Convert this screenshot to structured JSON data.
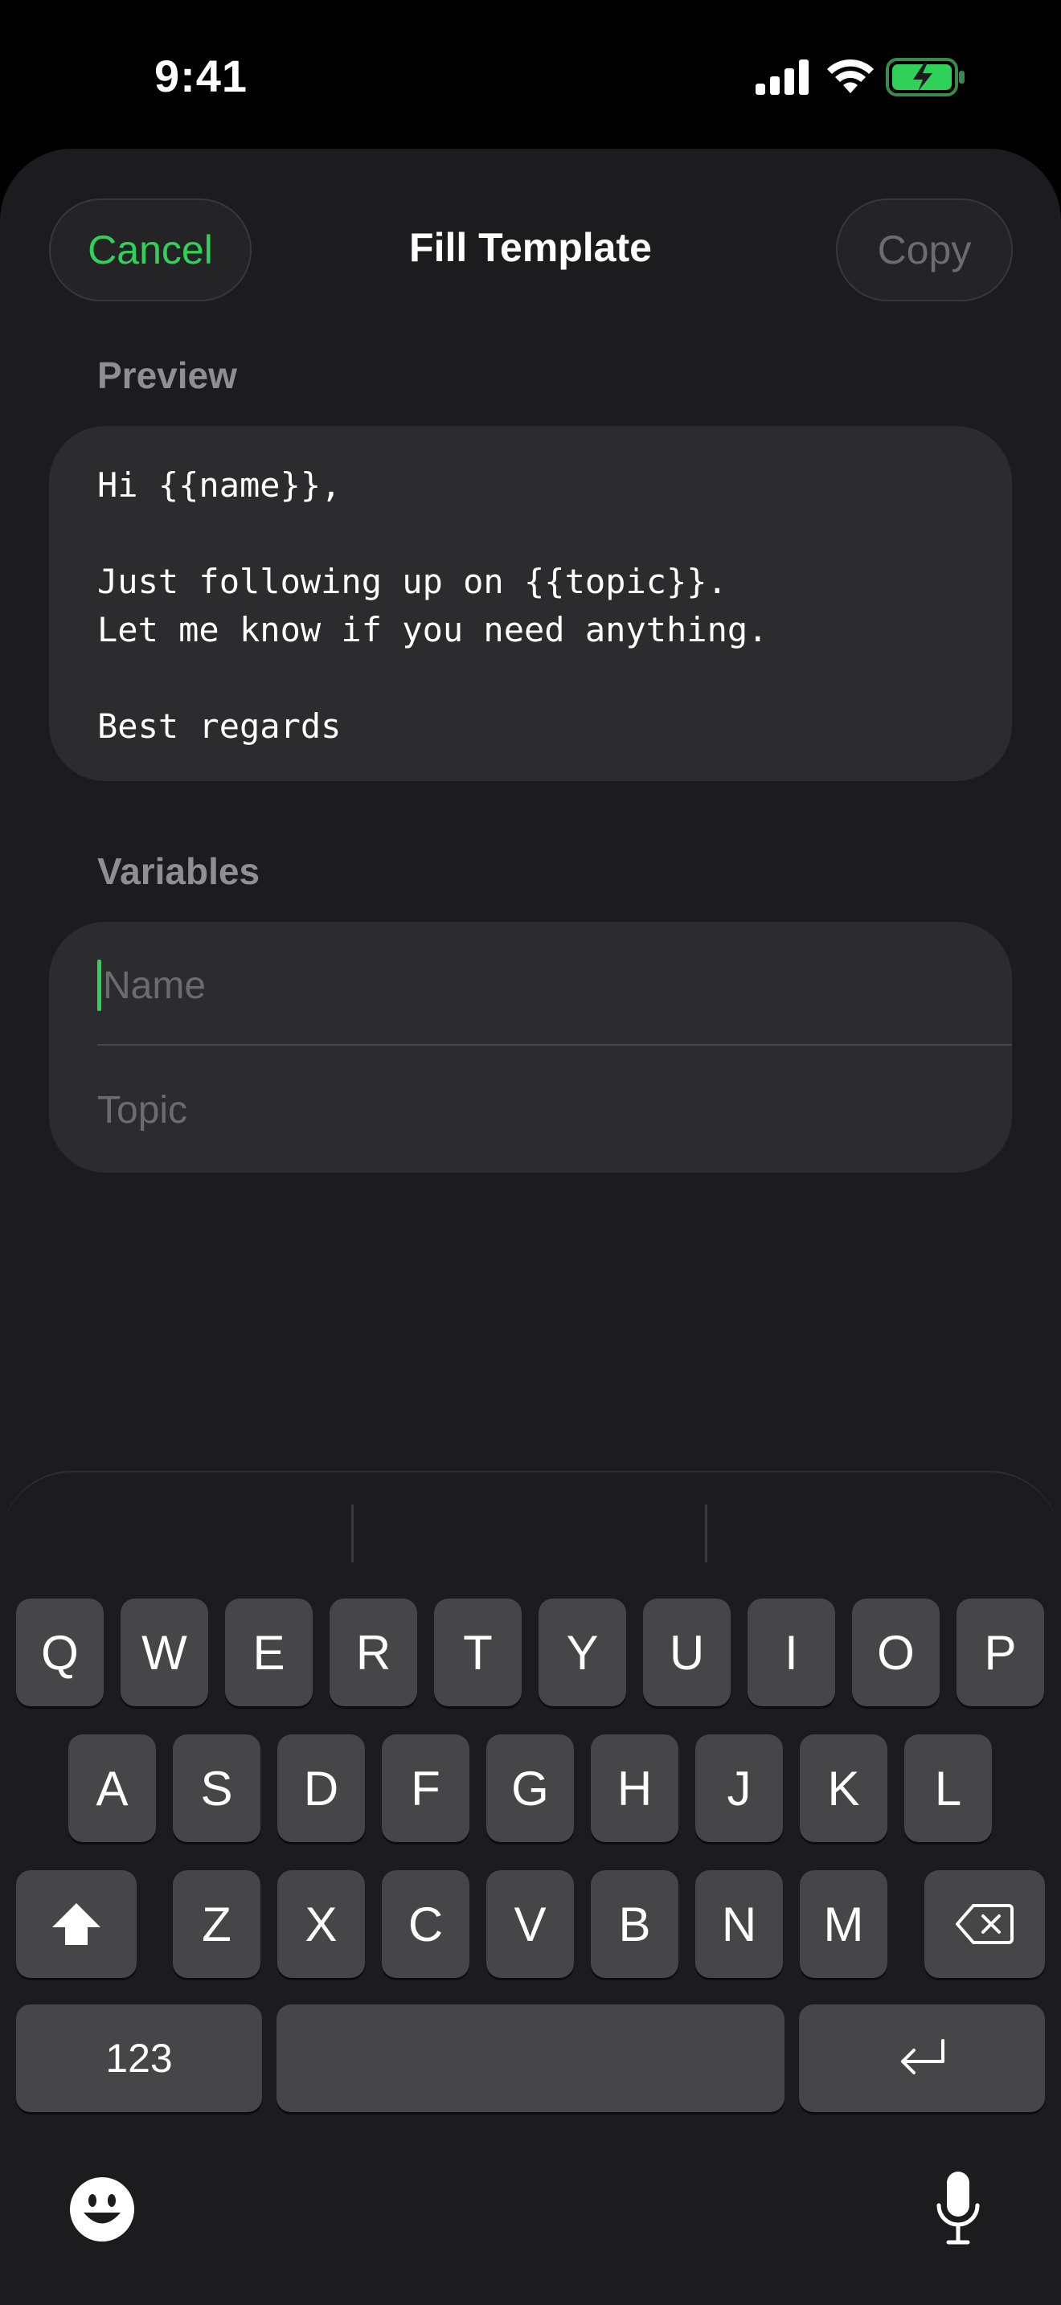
{
  "status_bar": {
    "time": "9:41"
  },
  "header": {
    "cancel_label": "Cancel",
    "title": "Fill Template",
    "copy_label": "Copy"
  },
  "preview": {
    "label": "Preview",
    "text": "Hi {{name}},\n\nJust following up on {{topic}}.\nLet me know if you need anything.\n\nBest regards"
  },
  "variables": {
    "label": "Variables",
    "fields": [
      {
        "placeholder": "Name",
        "value": ""
      },
      {
        "placeholder": "Topic",
        "value": ""
      }
    ]
  },
  "keyboard": {
    "row1": [
      "Q",
      "W",
      "E",
      "R",
      "T",
      "Y",
      "U",
      "I",
      "O",
      "P"
    ],
    "row2": [
      "A",
      "S",
      "D",
      "F",
      "G",
      "H",
      "J",
      "K",
      "L"
    ],
    "row3": [
      "Z",
      "X",
      "C",
      "V",
      "B",
      "N",
      "M"
    ],
    "numbers_label": "123",
    "icons": [
      "shift-icon",
      "delete-icon",
      "return-icon",
      "emoji-icon",
      "microphone-icon"
    ]
  },
  "colors": {
    "accent": "#30d158",
    "background": "#1c1c1e",
    "card": "#2c2c2e"
  }
}
